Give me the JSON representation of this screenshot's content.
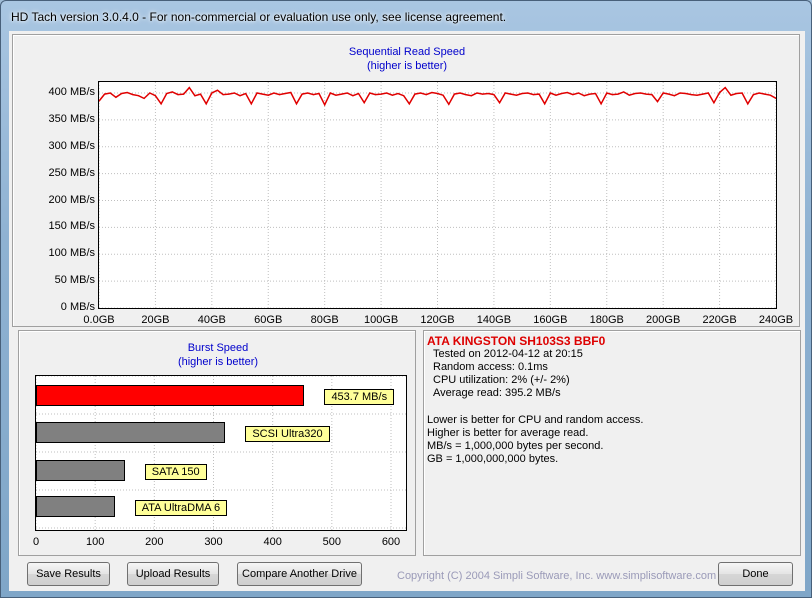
{
  "window": {
    "title": "HD Tach version 3.0.4.0  - For non-commercial or evaluation use only, see license agreement."
  },
  "sequential_chart": {
    "title": "Sequential Read Speed",
    "subtitle": "(higher is better)",
    "y_ticks": [
      "400 MB/s",
      "350 MB/s",
      "300 MB/s",
      "250 MB/s",
      "200 MB/s",
      "150 MB/s",
      "100 MB/s",
      "50 MB/s",
      "0 MB/s"
    ],
    "x_ticks": [
      "0.0GB",
      "20GB",
      "40GB",
      "60GB",
      "80GB",
      "100GB",
      "120GB",
      "140GB",
      "160GB",
      "180GB",
      "200GB",
      "220GB",
      "240GB"
    ],
    "line_color": "#e00000"
  },
  "burst_chart": {
    "title": "Burst Speed",
    "subtitle": "(higher is better)",
    "x_ticks": [
      "0",
      "100",
      "200",
      "300",
      "400",
      "500",
      "600"
    ],
    "bars": [
      {
        "label": "453.7 MB/s",
        "value": 453.7,
        "color": "#ff0000"
      },
      {
        "label": "SCSI Ultra320",
        "value": 320,
        "color": "#808080"
      },
      {
        "label": "SATA 150",
        "value": 150,
        "color": "#808080"
      },
      {
        "label": "ATA UltraDMA 6",
        "value": 133,
        "color": "#808080"
      }
    ]
  },
  "info": {
    "drive_name": "ATA KINGSTON SH103S3 BBF0",
    "tested_on": "Tested on 2012-04-12 at 20:15",
    "random_access": "Random access: 0.1ms",
    "cpu_utilization": "CPU utilization: 2% (+/- 2%)",
    "average_read": "Average read: 395.2 MB/s",
    "note1": "Lower is better for CPU and random access.",
    "note2": "Higher is better for average read.",
    "note3": "MB/s = 1,000,000 bytes per second.",
    "note4": "GB = 1,000,000,000 bytes."
  },
  "buttons": {
    "save": "Save Results",
    "upload": "Upload Results",
    "compare": "Compare Another Drive",
    "done": "Done"
  },
  "copyright": "Copyright (C) 2004 Simpli Software, Inc. www.simplisoftware.com",
  "chart_data": [
    {
      "type": "line",
      "title": "Sequential Read Speed",
      "subtitle": "(higher is better)",
      "xlabel": "",
      "ylabel": "",
      "xlim": [
        0,
        240
      ],
      "ylim": [
        0,
        400
      ],
      "x_unit": "GB",
      "y_unit": "MB/s",
      "grid": true,
      "series": [
        {
          "x": [
            0,
            2,
            4,
            6,
            8,
            10,
            12,
            14,
            16,
            18,
            20,
            22,
            24,
            26,
            28,
            30,
            32,
            34,
            36,
            38,
            40,
            42,
            44,
            46,
            48,
            50,
            52,
            54,
            56,
            58,
            60,
            62,
            64,
            66,
            68,
            70,
            72,
            74,
            76,
            78,
            80,
            82,
            84,
            86,
            88,
            90,
            92,
            94,
            96,
            98,
            100,
            102,
            104,
            106,
            108,
            110,
            112,
            114,
            116,
            118,
            120,
            122,
            124,
            126,
            128,
            130,
            132,
            134,
            136,
            138,
            140,
            142,
            144,
            146,
            148,
            150,
            152,
            154,
            156,
            158,
            160,
            162,
            164,
            166,
            168,
            170,
            172,
            174,
            176,
            178,
            180,
            182,
            184,
            186,
            188,
            190,
            192,
            194,
            196,
            198,
            200,
            202,
            204,
            206,
            208,
            210,
            212,
            214,
            216,
            218,
            220,
            222,
            224,
            226,
            228,
            230,
            232,
            234,
            236,
            238,
            240
          ],
          "y": [
            385,
            398,
            400,
            392,
            399,
            401,
            397,
            395,
            390,
            400,
            395,
            380,
            399,
            402,
            397,
            398,
            410,
            395,
            398,
            380,
            400,
            405,
            397,
            398,
            400,
            395,
            399,
            380,
            400,
            398,
            396,
            400,
            397,
            399,
            401,
            380,
            398,
            400,
            397,
            399,
            378,
            400,
            396,
            398,
            400,
            395,
            399,
            382,
            400,
            397,
            398,
            400,
            396,
            399,
            395,
            380,
            398,
            400,
            397,
            401,
            399,
            396,
            379,
            398,
            400,
            397,
            395,
            400,
            398,
            399,
            397,
            382,
            400,
            398,
            396,
            399,
            400,
            397,
            398,
            380,
            400,
            396,
            399,
            401,
            397,
            400,
            395,
            398,
            399,
            380,
            400,
            397,
            398,
            402,
            396,
            399,
            400,
            398,
            397,
            384,
            400,
            398,
            395,
            400,
            399,
            397,
            396,
            398,
            400,
            382,
            401,
            410,
            396,
            399,
            400,
            380,
            397,
            400,
            398,
            396,
            390
          ]
        }
      ]
    },
    {
      "type": "bar",
      "title": "Burst Speed",
      "subtitle": "(higher is better)",
      "orientation": "horizontal",
      "categories": [
        "453.7 MB/s",
        "SCSI Ultra320",
        "SATA 150",
        "ATA UltraDMA 6"
      ],
      "values": [
        453.7,
        320,
        150,
        133
      ],
      "xlim": [
        0,
        600
      ],
      "grid": true
    }
  ]
}
